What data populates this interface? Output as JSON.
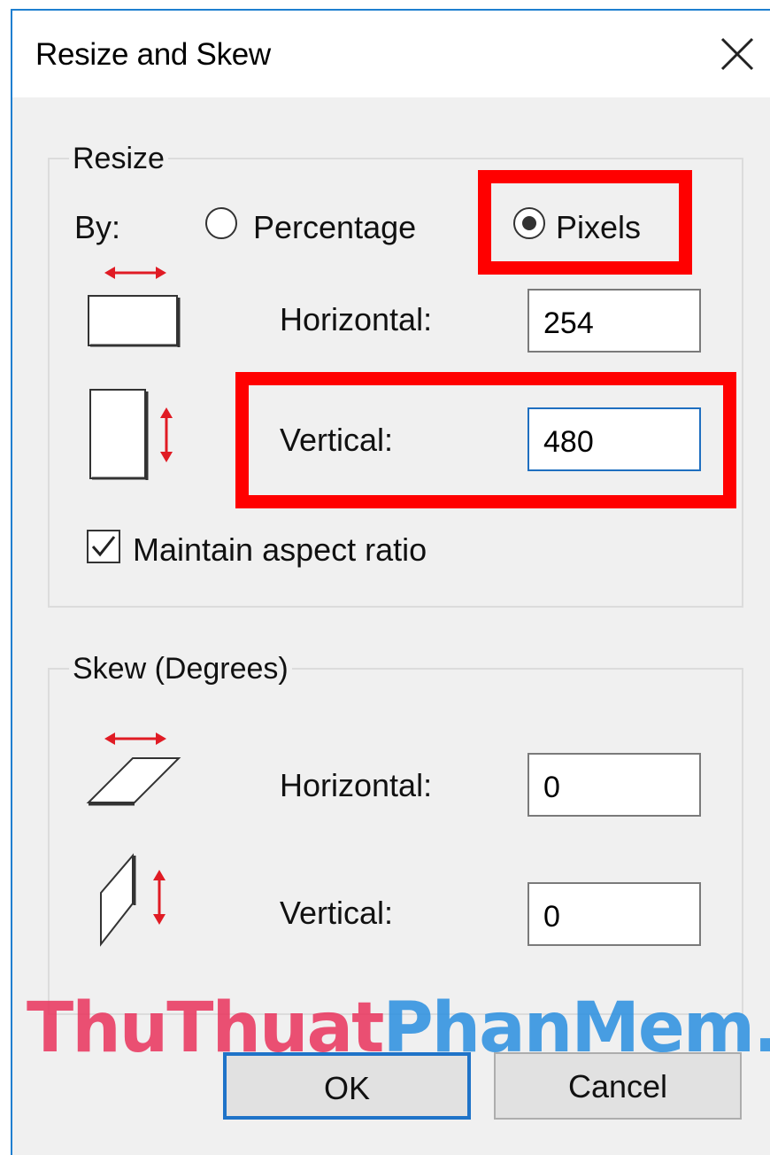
{
  "window": {
    "title": "Resize and Skew"
  },
  "resize": {
    "legend": "Resize",
    "by_label": "By:",
    "options": [
      {
        "label": "Percentage",
        "selected": false
      },
      {
        "label": "Pixels",
        "selected": true
      }
    ],
    "horizontal_label": "Horizontal:",
    "horizontal_value": "254",
    "vertical_label": "Vertical:",
    "vertical_value": "480",
    "maintain_label": "Maintain aspect ratio",
    "maintain_checked": true
  },
  "skew": {
    "legend": "Skew (Degrees)",
    "horizontal_label": "Horizontal:",
    "horizontal_value": "0",
    "vertical_label": "Vertical:",
    "vertical_value": "0"
  },
  "buttons": {
    "ok": "OK",
    "cancel": "Cancel"
  },
  "watermark": {
    "part1": "ThuThuat",
    "part2": "PhanMem.vn"
  },
  "colors": {
    "accent": "#1f73c8",
    "highlight": "#ff0000",
    "arrow": "#e01b24"
  }
}
